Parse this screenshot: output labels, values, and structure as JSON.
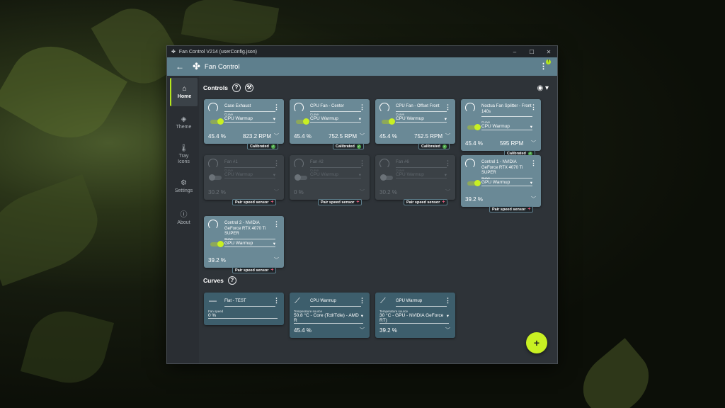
{
  "window": {
    "title": "Fan Control V214 (userConfig.json)",
    "minimize": "–",
    "maximize": "☐",
    "close": "✕"
  },
  "appbar": {
    "title": "Fan Control",
    "notification": "!"
  },
  "sidebar": {
    "items": [
      {
        "label": "Home",
        "icon": "home-icon"
      },
      {
        "label": "Theme",
        "icon": "paint-bucket-icon"
      },
      {
        "label": "Tray Icons",
        "icon": "thermometer-icon"
      },
      {
        "label": "Settings",
        "icon": "gear-icon"
      },
      {
        "label": "About",
        "icon": "info-icon"
      }
    ]
  },
  "controls": {
    "title": "Controls",
    "help": "?",
    "items": [
      {
        "name": "Case Exhaust",
        "curve_label": "Curve",
        "curve": "CPU Warmup",
        "percent": "45.4 %",
        "rpm": "823.2 RPM",
        "badge": "Calibrated",
        "enabled": true
      },
      {
        "name": "CPU Fan - Center",
        "curve_label": "Curve",
        "curve": "CPU Warmup",
        "percent": "45.4 %",
        "rpm": "752.5 RPM",
        "badge": "Calibrated",
        "enabled": true
      },
      {
        "name": "CPU Fan - Offset Front",
        "curve_label": "Curve",
        "curve": "CPU Warmup",
        "percent": "45.4 %",
        "rpm": "752.5 RPM",
        "badge": "Calibrated",
        "enabled": true
      },
      {
        "name": "Noctua Fan Splitter - Front 140s",
        "curve_label": "Curve",
        "curve": "CPU Warmup",
        "percent": "45.4 %",
        "rpm": "595 RPM",
        "badge": "Calibrated",
        "enabled": true
      },
      {
        "name": "Fan #1",
        "curve_label": "Curve",
        "curve": "CPU Warmup",
        "percent": "30.2 %",
        "rpm": "",
        "badge": "Pair speed sensor",
        "enabled": false
      },
      {
        "name": "Fan #2",
        "curve_label": "Curve",
        "curve": "CPU Warmup",
        "percent": "0 %",
        "rpm": "",
        "badge": "Pair speed sensor",
        "enabled": false
      },
      {
        "name": "Fan #6",
        "curve_label": "Curve",
        "curve": "CPU Warmup",
        "percent": "30.2 %",
        "rpm": "",
        "badge": "Pair speed sensor",
        "enabled": false
      },
      {
        "name": "Control 1 - NVIDIA GeForce RTX 4070 Ti SUPER",
        "curve_label": "Curve",
        "curve": "GPU Warmup",
        "percent": "39.2 %",
        "rpm": "",
        "badge": "Pair speed sensor",
        "enabled": true
      },
      {
        "name": "Control 2 - NVIDIA GeForce RTX 4070 Ti SUPER",
        "curve_label": "Curve",
        "curve": "GPU Warmup",
        "percent": "39.2 %",
        "rpm": "",
        "badge": "Pair speed sensor",
        "enabled": true
      }
    ]
  },
  "curves": {
    "title": "Curves",
    "help": "?",
    "items": [
      {
        "name": "Flat - TEST",
        "field_label": "Fan speed",
        "field": "0 %",
        "value": "",
        "icon": "flat-line-icon"
      },
      {
        "name": "CPU Warmup",
        "field_label": "Temperature source",
        "field": "50.8 °C - Core (Tctl/Tdie) - AMD R",
        "value": "45.4 %",
        "icon": "trend-line-icon"
      },
      {
        "name": "GPU Warmup",
        "field_label": "Temperature source",
        "field": "30 °C - GPU - NVIDIA GeForce RT)",
        "value": "39.2 %",
        "icon": "trend-line-icon"
      }
    ]
  },
  "fab": {
    "label": "+"
  }
}
